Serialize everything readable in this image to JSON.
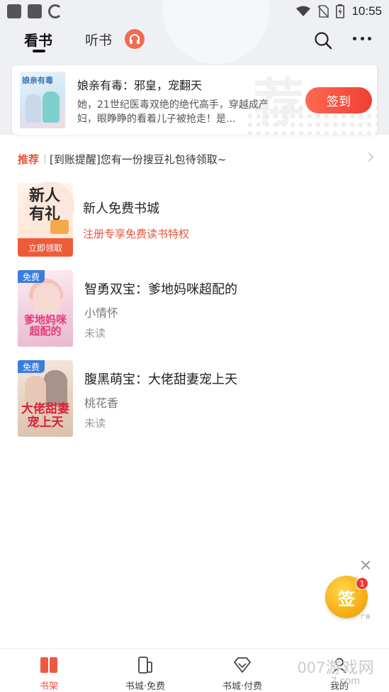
{
  "status_bar": {
    "time": "10:55"
  },
  "header": {
    "tab_read": "看书",
    "tab_listen": "听书"
  },
  "promo": {
    "cover_title": "娘亲有毒",
    "title": "娘亲有毒：邪皇，宠翻天",
    "description": "她，21世纪医毒双绝的绝代高手，穿越成产妇，眼睁睁的看着儿子被抢走！是...",
    "watermark": "荐",
    "signin_label": "签到"
  },
  "notice": {
    "tag": "推荐",
    "text": "[到账提醒]您有一份搜豆礼包待领取~"
  },
  "newbie": {
    "cover_text_line1": "新人",
    "cover_text_line2": "有礼",
    "cover_cta": "立即领取",
    "title": "新人免费书城",
    "subtitle": "注册专享免费读书特权"
  },
  "books": [
    {
      "badge": "免费",
      "cover_title": "爹地妈咪超配的",
      "title": "智勇双宝：爹地妈咪超配的",
      "author": "小情怀",
      "status": "未读"
    },
    {
      "badge": "免费",
      "cover_title": "大佬甜妻宠上天",
      "title": "腹黑萌宝：大佬甜妻宠上天",
      "author": "桃花香",
      "status": "未读"
    }
  ],
  "float": {
    "label": "签",
    "badge": "1",
    "ad": "广告"
  },
  "bottom_nav": {
    "items": [
      {
        "label": "书架"
      },
      {
        "label": "书城·免费"
      },
      {
        "label": "书城·付费"
      },
      {
        "label": "我的"
      }
    ]
  },
  "watermark": {
    "line1": "007游戏网",
    "line2": "7.com"
  },
  "colors": {
    "accent": "#e8543d",
    "free_badge": "#3b7ddd",
    "signin_gradient_end": "#ef3f34"
  }
}
